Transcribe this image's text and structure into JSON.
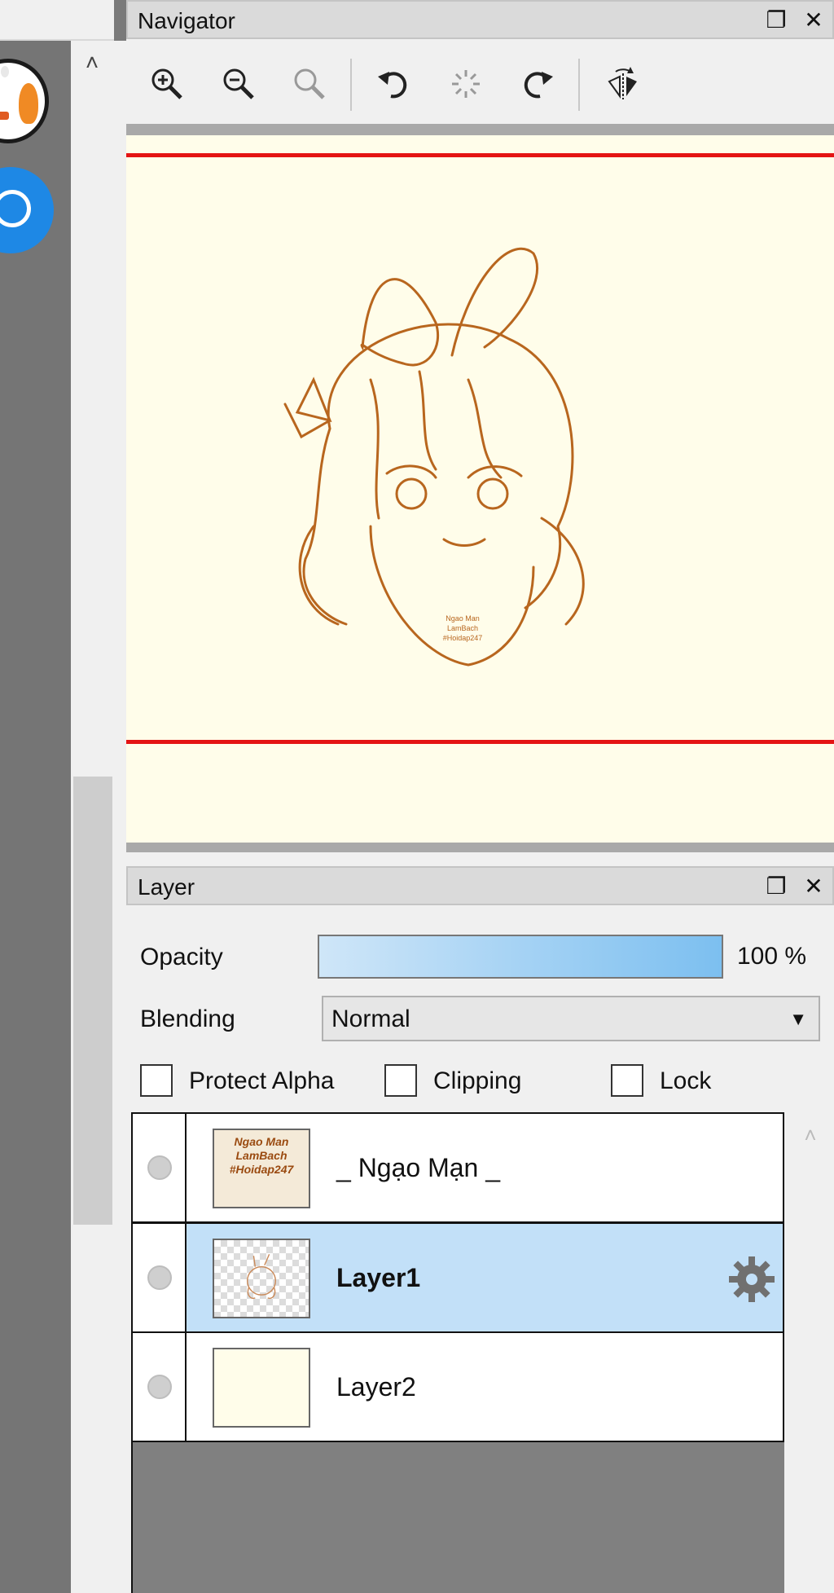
{
  "navigator": {
    "title": "Navigator",
    "float_icon": "restore-window-icon",
    "close_icon": "close-icon",
    "toolbar": [
      {
        "name": "zoom-in-icon"
      },
      {
        "name": "zoom-out-icon"
      },
      {
        "name": "zoom-reset-icon"
      },
      {
        "name": "rotate-left-icon"
      },
      {
        "name": "rotate-reset-icon"
      },
      {
        "name": "rotate-right-icon"
      },
      {
        "name": "flip-horizontal-icon"
      }
    ],
    "canvas_bg": "#fffdea",
    "frame_color": "#e41414",
    "artwork_caption": [
      "Ngao Man",
      "LamBach",
      "#Hoidap247"
    ]
  },
  "layer": {
    "title": "Layer",
    "opacity_label": "Opacity",
    "opacity_value": "100 %",
    "opacity": 1.0,
    "blending_label": "Blending",
    "blending_value": "Normal",
    "protect_alpha_label": "Protect Alpha",
    "clipping_label": "Clipping",
    "lock_label": "Lock",
    "layers": [
      {
        "name": "_ Ngạo Mạn _",
        "thumb_text": [
          "Ngao Man",
          "LamBach",
          "#Hoidap247"
        ],
        "selected": false
      },
      {
        "name": "Layer1",
        "selected": true
      },
      {
        "name": "Layer2",
        "selected": false
      }
    ],
    "selected_color": "#c2e0f8"
  }
}
